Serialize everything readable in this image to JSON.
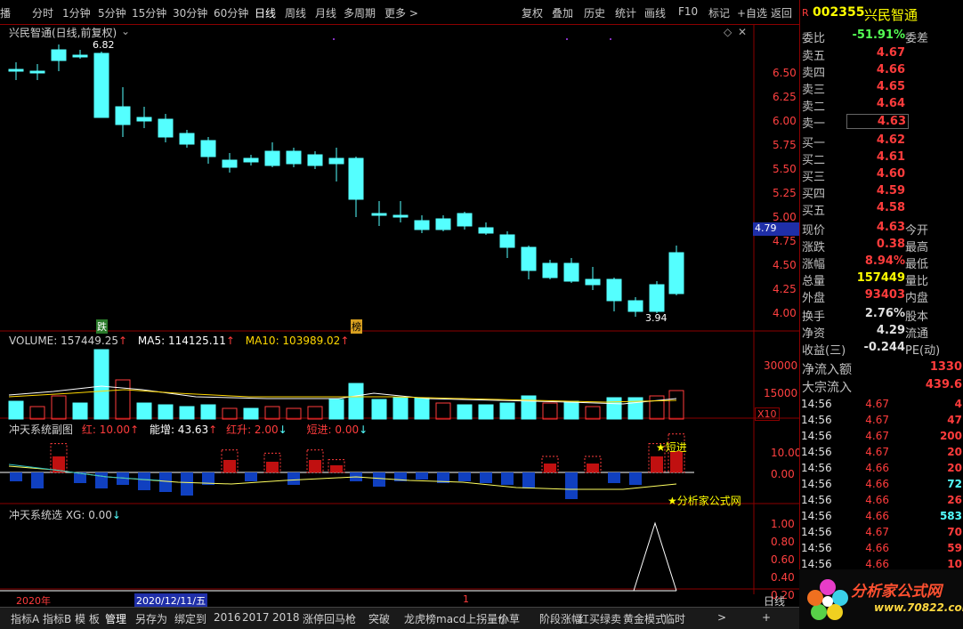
{
  "topbar": {
    "items": [
      "播",
      "分时",
      "1分钟",
      "5分钟",
      "15分钟",
      "30分钟",
      "60分钟",
      "日线",
      "周线",
      "月线",
      "多周期",
      "更多 >"
    ],
    "right_items": [
      "复权",
      "叠加",
      "历史",
      "统计",
      "画线",
      "F10",
      "标记",
      "+自选",
      "返回"
    ]
  },
  "main": {
    "title": "兴民智通(日线,前复权)",
    "high_label": "6.82",
    "low_label": "3.94",
    "price_axis": [
      "6.50",
      "6.25",
      "6.00",
      "5.75",
      "5.50",
      "5.25",
      "5.00",
      "4.75",
      "4.50",
      "4.25",
      "4.00"
    ],
    "current_price_tag": "4.79",
    "marker_down": "跌",
    "marker_board": "榜"
  },
  "volume": {
    "label": "VOLUME: 157449.25",
    "ma5": "MA5: 114125.11",
    "ma10": "MA10: 103989.02",
    "axis": [
      "30000",
      "15000"
    ],
    "unit": "X10"
  },
  "sub1": {
    "title": "冲天系统副图",
    "red": "红: 10.00",
    "energy": "能增: 43.63",
    "rise": "红升: 2.00",
    "short": "短进: 0.00",
    "axis": [
      "10.00",
      "0.00"
    ],
    "badge": "★短进",
    "watermark": "★分析家公式网"
  },
  "sub2": {
    "title": "冲天系统选 XG: 0.00",
    "axis": [
      "1.00",
      "0.80",
      "0.60",
      "0.40",
      "0.20"
    ]
  },
  "timeline": {
    "year": "2020年",
    "date": "2020/12/11/五",
    "mark": "1",
    "mode": "日线"
  },
  "right": {
    "code": "002355",
    "name": "兴民智通",
    "weibi_label": "委比",
    "weibi_value": "-51.91%",
    "weicha_label": "委差",
    "asks": [
      {
        "label": "卖五",
        "price": "4.67"
      },
      {
        "label": "卖四",
        "price": "4.66"
      },
      {
        "label": "卖三",
        "price": "4.65"
      },
      {
        "label": "卖二",
        "price": "4.64"
      },
      {
        "label": "卖一",
        "price": "4.63"
      }
    ],
    "bids": [
      {
        "label": "买一",
        "price": "4.62"
      },
      {
        "label": "买二",
        "price": "4.61"
      },
      {
        "label": "买三",
        "price": "4.60"
      },
      {
        "label": "买四",
        "price": "4.59"
      },
      {
        "label": "买五",
        "price": "4.58"
      }
    ],
    "stats": [
      {
        "l": "现价",
        "v": "4.63",
        "r": "今开",
        "c": "red"
      },
      {
        "l": "涨跌",
        "v": "0.38",
        "r": "最高",
        "c": "red"
      },
      {
        "l": "涨幅",
        "v": "8.94%",
        "r": "最低",
        "c": "red"
      },
      {
        "l": "总量",
        "v": "157449",
        "r": "量比",
        "c": "yellow"
      },
      {
        "l": "外盘",
        "v": "93403",
        "r": "内盘",
        "c": "red"
      }
    ],
    "stats2": [
      {
        "l": "换手",
        "v": "2.76%",
        "r": "股本",
        "c": "white"
      },
      {
        "l": "净资",
        "v": "4.29",
        "r": "流通",
        "c": "white"
      },
      {
        "l": "收益(三)",
        "v": "-0.244",
        "r": "PE(动)",
        "c": "white"
      }
    ],
    "flow": [
      {
        "l": "净流入额",
        "v": "1330"
      },
      {
        "l": "大宗流入",
        "v": "439.6"
      }
    ],
    "ticks": [
      {
        "t": "14:56",
        "p": "4.67",
        "v": "4",
        "c": "red"
      },
      {
        "t": "14:56",
        "p": "4.67",
        "v": "47",
        "c": "red"
      },
      {
        "t": "14:56",
        "p": "4.67",
        "v": "200",
        "c": "red"
      },
      {
        "t": "14:56",
        "p": "4.67",
        "v": "20",
        "c": "red"
      },
      {
        "t": "14:56",
        "p": "4.66",
        "v": "20",
        "c": "red"
      },
      {
        "t": "14:56",
        "p": "4.66",
        "v": "72",
        "c": "cyan"
      },
      {
        "t": "14:56",
        "p": "4.66",
        "v": "26",
        "c": "red"
      },
      {
        "t": "14:56",
        "p": "4.66",
        "v": "583",
        "c": "cyan"
      },
      {
        "t": "14:56",
        "p": "4.67",
        "v": "70",
        "c": "red"
      },
      {
        "t": "14:56",
        "p": "4.66",
        "v": "59",
        "c": "red"
      },
      {
        "t": "14:56",
        "p": "4.66",
        "v": "10",
        "c": "red"
      }
    ]
  },
  "bottombar": {
    "items": [
      "指标A",
      "指标B",
      "模 板",
      "管理",
      "另存为",
      "绑定到",
      "2016",
      "2017",
      "2018",
      "涨停回马枪",
      "突破",
      "龙虎榜",
      "macd上拐量价",
      "小草",
      "阶段涨幅",
      "红买绿卖",
      "黄金模式",
      "临时",
      ">"
    ],
    "plus": "+"
  },
  "logo": {
    "text": "分析家公式网",
    "url": "www.70822.com"
  }
}
